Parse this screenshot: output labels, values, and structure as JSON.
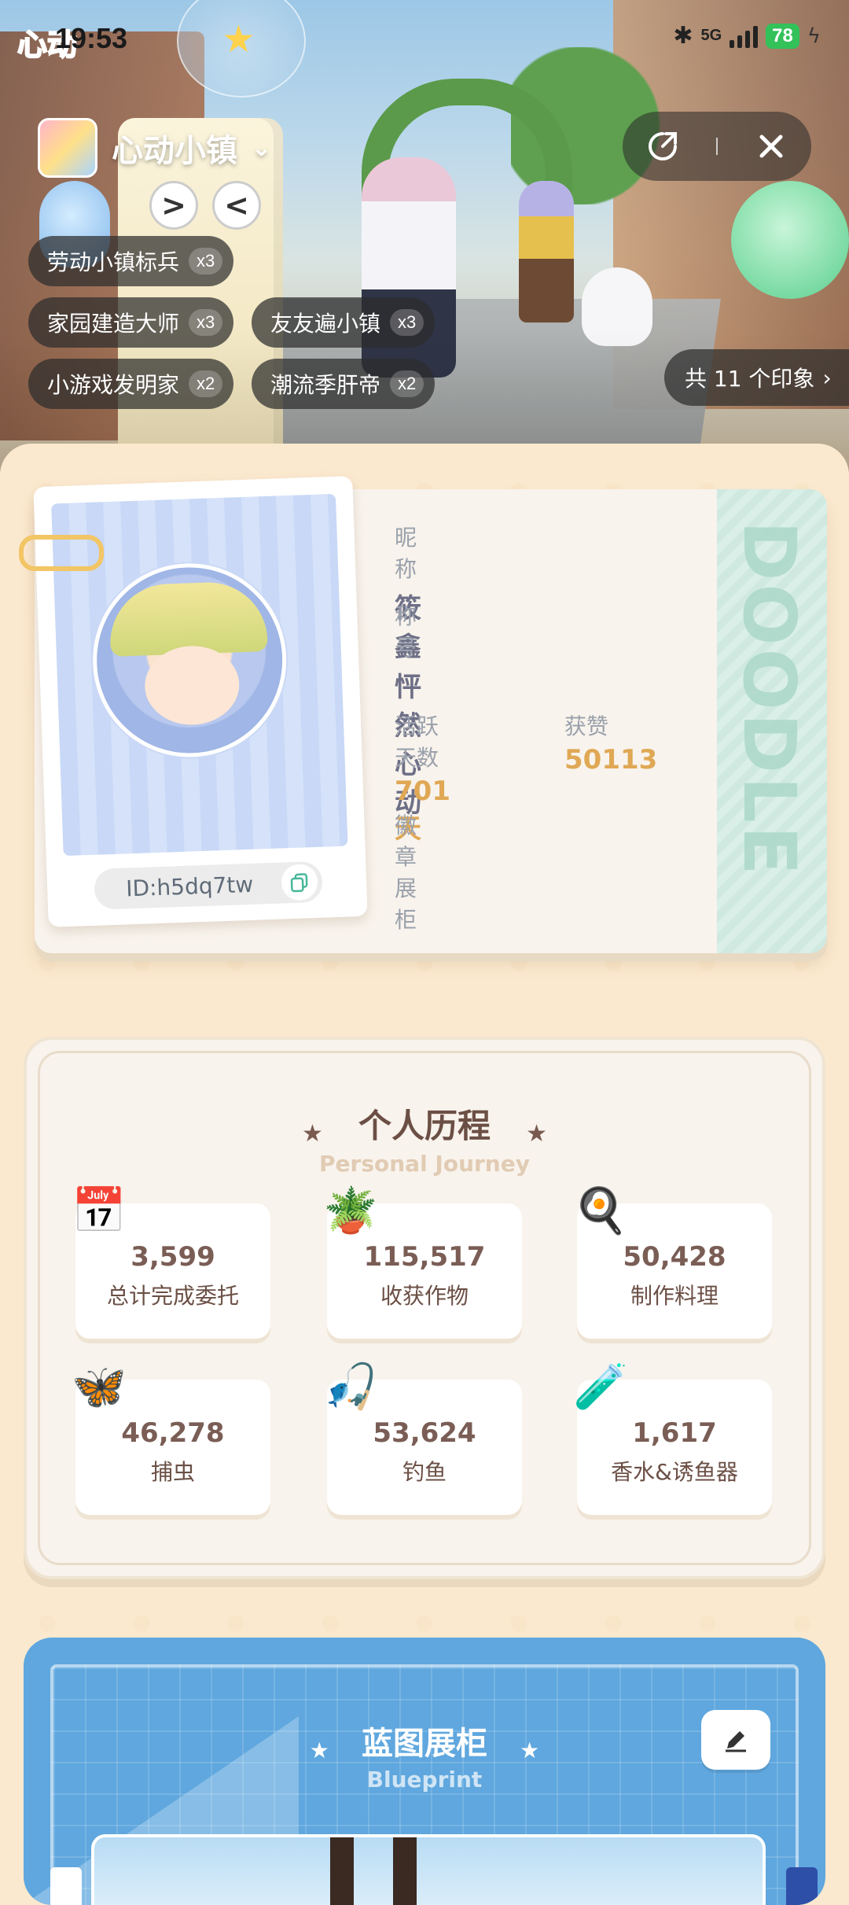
{
  "status_bar": {
    "time": "19:53",
    "logo_text": "心动",
    "network": "5G",
    "battery": "78",
    "colors": {
      "battery": "#33c15a"
    }
  },
  "game": {
    "name": "心动小镇",
    "icon": "game-icon"
  },
  "top_actions": {
    "share_icon": "share-icon",
    "close_icon": "close-icon"
  },
  "badges": [
    {
      "name": "劳动小镇标兵",
      "count": "x3"
    },
    {
      "name": "家园建造大师",
      "count": "x3"
    },
    {
      "name": "友友遍小镇",
      "count": "x3"
    },
    {
      "name": "小游戏发明家",
      "count": "x2"
    },
    {
      "name": "潮流季肝帝",
      "count": "x2"
    }
  ],
  "impressions": {
    "label": "共 11 个印象"
  },
  "profile": {
    "nickname_label": "昵称",
    "nickname": "筱鑫",
    "title_label": "称号",
    "title": "怦然心动",
    "active_days_label": "活跃天数",
    "active_days": "701天",
    "likes_label": "获赞",
    "likes": "50113",
    "badge_cabinet_label": "徽章展柜",
    "id_text": "ID:h5dq7tw",
    "stripe_text": "DOODLE",
    "colors": {
      "gold": "#e0a855",
      "stripe": "#cfe9e1"
    }
  },
  "journey": {
    "title": "个人历程",
    "subtitle": "Personal Journey",
    "stats": [
      {
        "value": "3,599",
        "label": "总计完成委托",
        "icon": "calendar-icon"
      },
      {
        "value": "115,517",
        "label": "收获作物",
        "icon": "watering-can-icon"
      },
      {
        "value": "50,428",
        "label": "制作料理",
        "icon": "stove-icon"
      },
      {
        "value": "46,278",
        "label": "捕虫",
        "icon": "bug-net-icon"
      },
      {
        "value": "53,624",
        "label": "钓鱼",
        "icon": "fishing-rod-icon"
      },
      {
        "value": "1,617",
        "label": "香水&诱鱼器",
        "icon": "perfume-icon"
      }
    ]
  },
  "blueprint": {
    "title": "蓝图展柜",
    "subtitle": "Blueprint",
    "colors": {
      "background": "#5fa7de"
    }
  }
}
